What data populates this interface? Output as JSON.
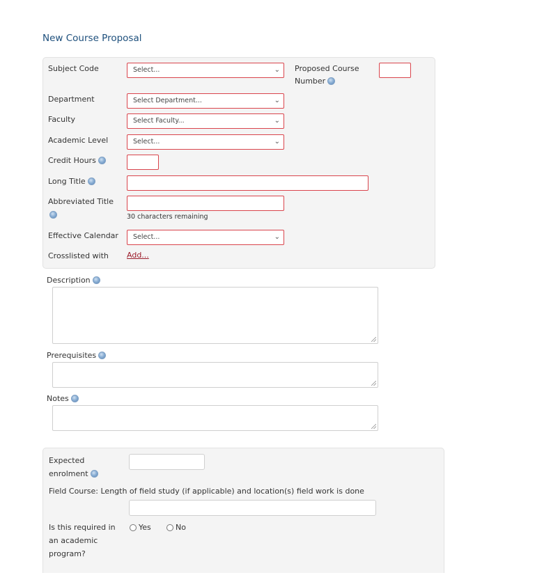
{
  "page": {
    "title": "New Course Proposal"
  },
  "details": {
    "subject_code": {
      "label": "Subject Code",
      "value": "Select..."
    },
    "proposed_course_number": {
      "label_line1": "Proposed Course",
      "label_line2": "Number",
      "value": ""
    },
    "department": {
      "label": "Department",
      "value": "Select Department..."
    },
    "faculty": {
      "label": "Faculty",
      "value": "Select Faculty..."
    },
    "academic_level": {
      "label": "Academic Level",
      "value": "Select..."
    },
    "credit_hours": {
      "label": "Credit Hours",
      "value": ""
    },
    "long_title": {
      "label": "Long Title",
      "value": ""
    },
    "abbreviated_title": {
      "label": "Abbreviated Title",
      "value": "",
      "remaining": "30 characters remaining"
    },
    "effective_calendar": {
      "label": "Effective Calendar",
      "value": "Select..."
    },
    "crosslisted": {
      "label": "Crosslisted with",
      "link": "Add..."
    }
  },
  "text_areas": {
    "description": {
      "label": "Description",
      "value": ""
    },
    "prerequisites": {
      "label": "Prerequisites",
      "value": ""
    },
    "notes": {
      "label": "Notes",
      "value": ""
    }
  },
  "extra": {
    "expected_enrolment": {
      "label_line1": "Expected",
      "label_line2": "enrolment",
      "value": ""
    },
    "field_course": {
      "label": "Field Course: Length of field study (if applicable) and location(s) field work is done",
      "value": ""
    },
    "required_program": {
      "label_line1": "Is this required in",
      "label_line2": "an academic",
      "label_line3": "program?",
      "options": [
        "Yes",
        "No"
      ],
      "selected": null
    }
  },
  "icons": {
    "help": "help-icon",
    "chevron": "chevron-down-icon"
  },
  "colors": {
    "title": "#1d4f7c",
    "required_border": "#d9444c",
    "link": "#9b1c2a",
    "panel_bg": "#f4f4f4"
  }
}
